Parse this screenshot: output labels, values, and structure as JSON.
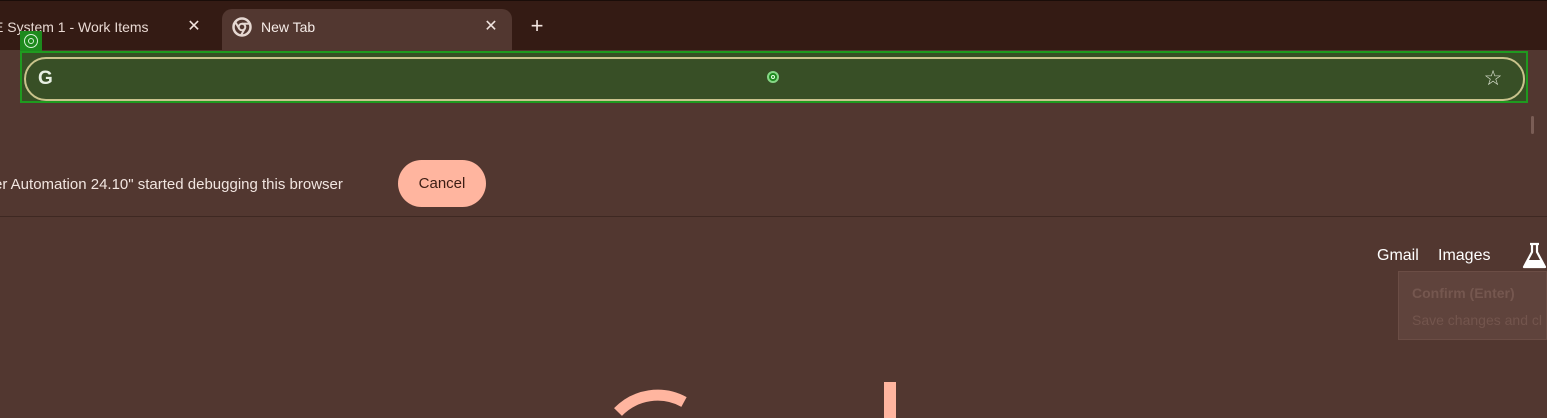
{
  "tabs": [
    {
      "title": "E System 1 - Work Items",
      "close_glyph": "✕",
      "active": false
    },
    {
      "title": "New Tab",
      "close_glyph": "✕",
      "active": true,
      "icon": "chrome-icon"
    }
  ],
  "new_tab_glyph": "+",
  "omnibox": {
    "value": "",
    "left_icon": "google-g-icon",
    "left_glyph": "G",
    "right_icon": "star-icon",
    "right_glyph": "☆"
  },
  "infobar": {
    "message": "er Automation 24.10\" started debugging this browser",
    "cancel_label": "Cancel"
  },
  "top_links": {
    "gmail": "Gmail",
    "images": "Images",
    "labs_icon": "flask-icon"
  },
  "tooltip": {
    "title": "Confirm (Enter)",
    "subtitle": "Save changes and cl"
  },
  "colors": {
    "page_bg": "#523730",
    "tabstrip_bg": "#341b14",
    "highlight_green": "#1f9a1f",
    "omnibox_fill": "#384f26",
    "cancel_button_bg": "#ffb59f",
    "logo_color": "#ffb59f"
  }
}
